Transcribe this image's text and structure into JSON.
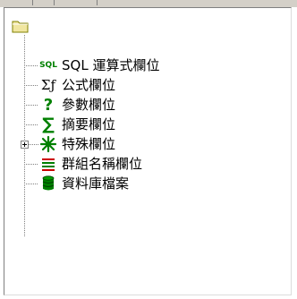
{
  "tree": {
    "root_icon": "folder-icon",
    "items": [
      {
        "icon": "sql-icon",
        "icon_text": "SQL",
        "label": "SQL 運算式欄位"
      },
      {
        "icon": "formula-icon",
        "icon_text": "Σƒ",
        "label": "公式欄位"
      },
      {
        "icon": "question-mark-icon",
        "icon_text": "?",
        "label": "參數欄位"
      },
      {
        "icon": "sigma-icon",
        "icon_text": "∑",
        "label": "摘要欄位"
      },
      {
        "icon": "special-star-icon",
        "icon_text": "",
        "label": "特殊欄位",
        "expandable": true
      },
      {
        "icon": "group-lines-icon",
        "icon_text": "",
        "label": "群組名稱欄位"
      },
      {
        "icon": "database-icon",
        "icon_text": "",
        "label": "資料庫檔案"
      }
    ]
  },
  "colors": {
    "icon_green": "#008000",
    "icon_red": "#cc0000",
    "folder_yellow": "#f0e6a0",
    "panel_border": "#808080"
  }
}
